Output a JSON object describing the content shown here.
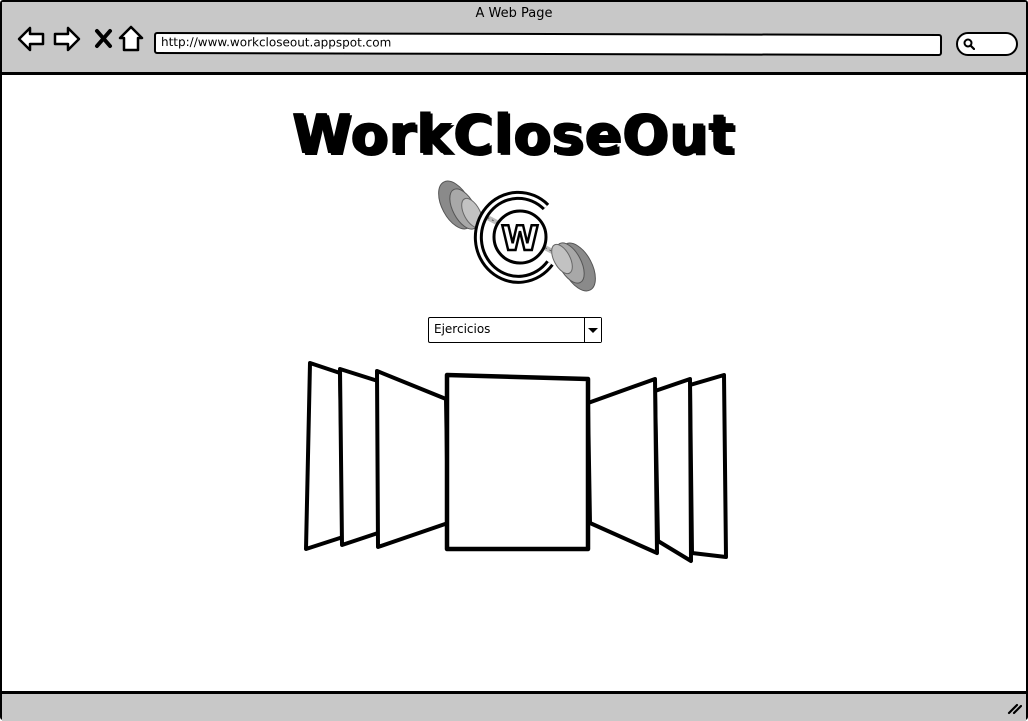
{
  "window": {
    "title": "A Web Page"
  },
  "toolbar": {
    "back_icon": "arrow-left-icon",
    "forward_icon": "arrow-right-icon",
    "stop_icon": "close-icon",
    "home_icon": "home-icon",
    "url": "http://www.workcloseout.appspot.com",
    "search_icon": "search-icon"
  },
  "page": {
    "site_title": "WorkCloseOut",
    "logo_icon": "barbell-logo-icon",
    "logo_letter": "W",
    "dropdown": {
      "selected": "Ejercicios"
    },
    "carousel": {
      "panel_count": 7,
      "featured_index": 3
    }
  },
  "colors": {
    "chrome": "#c8c8c8",
    "border": "#000000",
    "background": "#ffffff",
    "weight_plate": "#8a8a8a"
  }
}
